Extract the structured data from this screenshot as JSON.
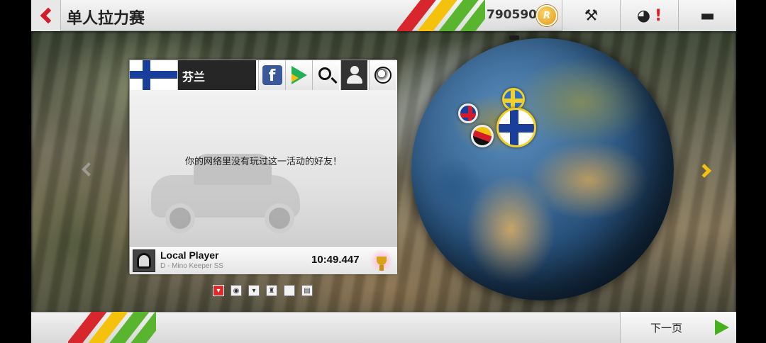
{
  "header": {
    "title": "单人拉力赛",
    "coins": "790590",
    "coin_icon": "rr-coin-icon",
    "tools_icon": "wrench-screwdriver-icon",
    "profile_icon": "helmet-icon",
    "alert_mark": "!",
    "chat_icon": "chat-bubble-icon"
  },
  "panel": {
    "country": "芬兰",
    "social_icons": [
      "facebook-icon",
      "google-play-icon",
      "search-icon",
      "friends-icon",
      "globe-icon"
    ],
    "empty_message": "你的网络里没有玩过这一活动的好友！",
    "player": {
      "name": "Local Player",
      "car": "D - Mino Keeper SS",
      "time": "10:49.447"
    }
  },
  "categories": [
    "trophy-icon",
    "wheel-icon",
    "cup-icon",
    "piece-icon",
    "blank-icon",
    "lock-icon"
  ],
  "footer": {
    "next_label": "下一页"
  },
  "colors": {
    "accent_red": "#d7262c",
    "accent_yellow": "#f4c20d",
    "accent_green": "#5ab52e"
  }
}
